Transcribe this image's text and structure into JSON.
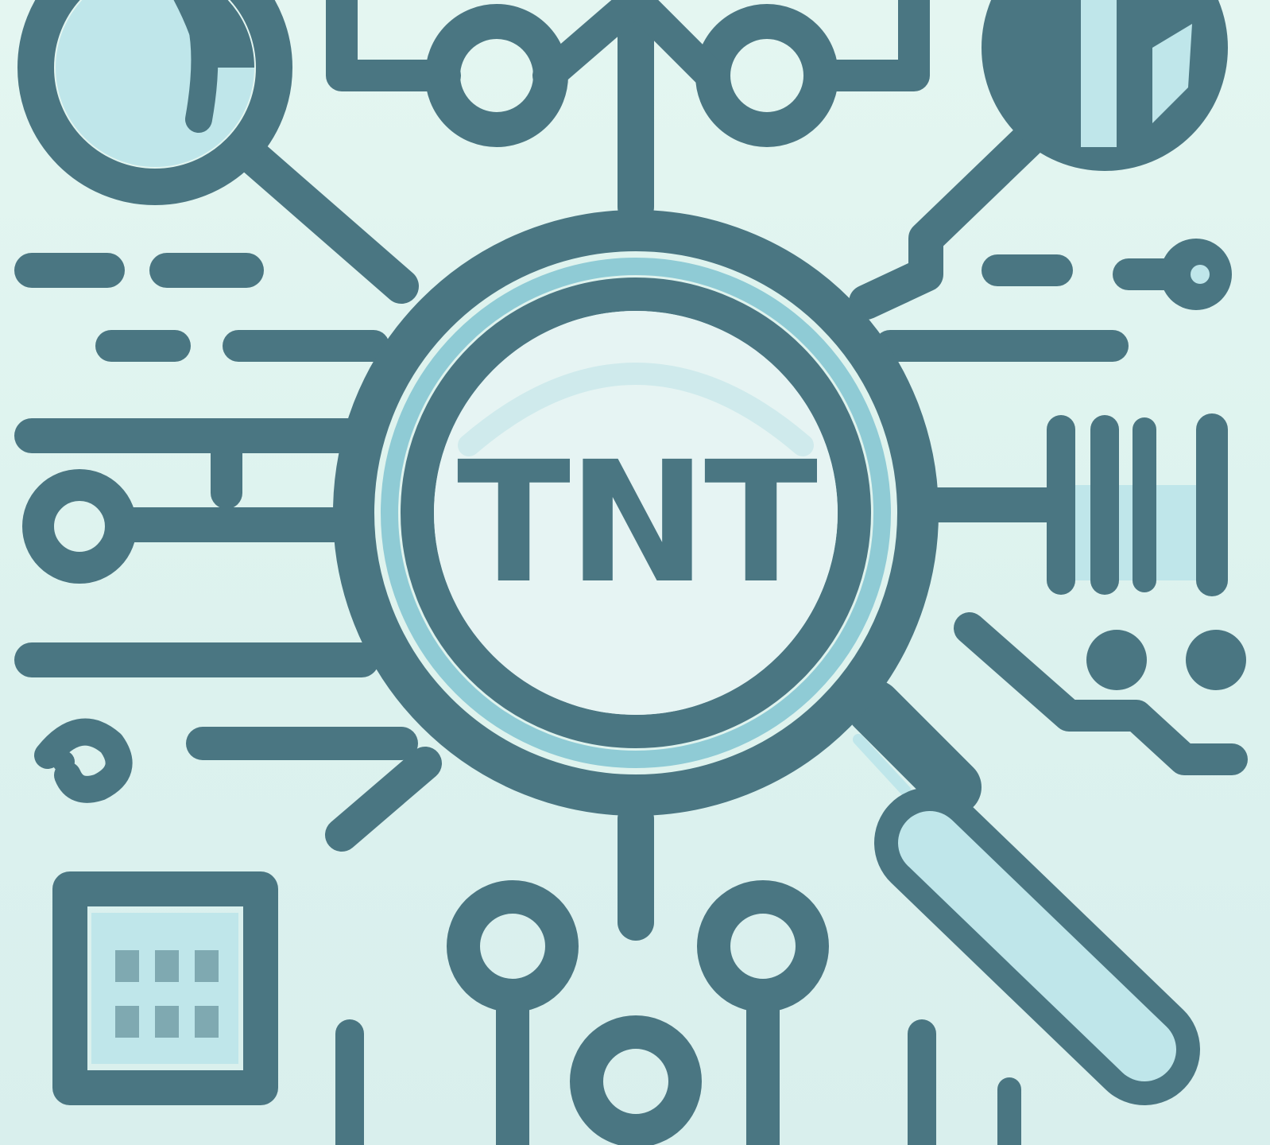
{
  "logo": {
    "text": "TNT"
  },
  "colors": {
    "background": "#dff3ee",
    "primary_stroke": "#4a7682",
    "accent_light": "#bfe6ea",
    "lens_fill": "#e6f4f3"
  },
  "icons": [
    "magnifying-glass-icon",
    "network-node-icon",
    "pie-chart-icon",
    "bar-chart-icon",
    "document-icon"
  ]
}
